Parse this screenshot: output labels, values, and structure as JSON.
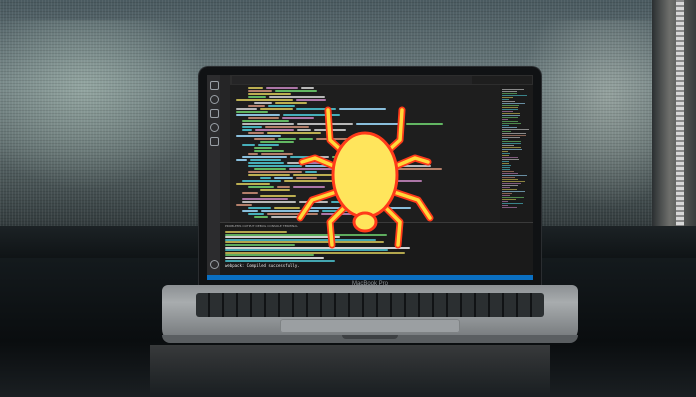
{
  "scene": {
    "description_tags": [
      "laptop-on-desk",
      "code-editor-on-screen",
      "spider-overlay"
    ]
  },
  "laptop": {
    "brand_label": "MacBook Pro"
  },
  "editor": {
    "tabs": [
      "",
      "",
      "",
      "",
      "",
      ""
    ],
    "panel_tabs": "PROBLEMS   OUTPUT   DEBUG CONSOLE   TERMINAL",
    "terminal_last_line": "webpack: Compiled successfully."
  },
  "spider": {
    "body_color": "#ffe55c",
    "leg_color": "#ffd93a",
    "outline_color": "#ff3a1a"
  },
  "colors": {
    "status_bar": "#0a6fc2",
    "code_green": "#6fd16f",
    "code_yellow": "#d8c95a",
    "code_cyan": "#4ec9d6",
    "code_purple": "#c586c0"
  }
}
